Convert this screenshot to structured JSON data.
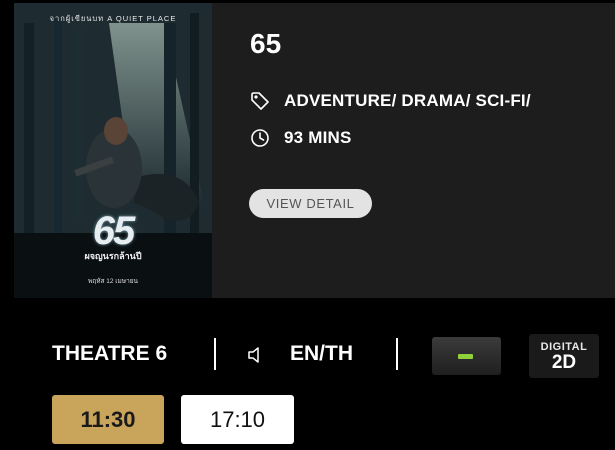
{
  "movie": {
    "title": "65",
    "genre": "ADVENTURE/ DRAMA/ SCI-FI/",
    "duration": "93 MINS",
    "view_detail_label": "VIEW DETAIL",
    "genre_icon": "tag-icon",
    "duration_icon": "clock-icon"
  },
  "poster": {
    "tagline": "จากผู้เขียนบท A QUIET PLACE",
    "title": "65",
    "thai_title": "ผจญนรกล้านปี",
    "release": "พฤหัส 12 เมษายน"
  },
  "session": {
    "theatre": "THEATRE 6",
    "audio": "EN/TH",
    "audio_icon": "speaker-icon",
    "format_badge_color": "#8ed13b",
    "digital_top": "DIGITAL",
    "digital_bottom": "2D"
  },
  "showtimes": [
    {
      "time": "11:30",
      "selected": true
    },
    {
      "time": "17:10",
      "selected": false
    }
  ],
  "colors": {
    "selected_showtime": "#c9a55c",
    "panel_bg": "#1d1d1d",
    "page_bg": "#000000"
  }
}
